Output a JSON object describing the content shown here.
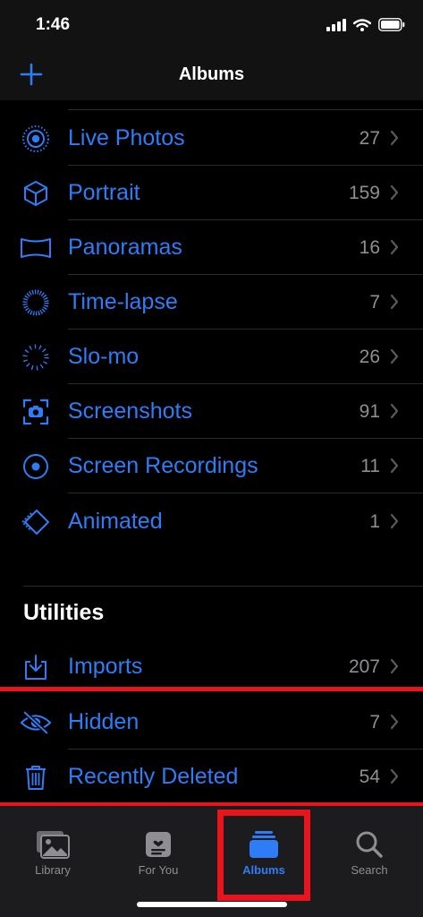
{
  "status_bar": {
    "time": "1:46"
  },
  "nav": {
    "title": "Albums",
    "add_icon": "plus-icon"
  },
  "media_types": [
    {
      "id": "live-photos",
      "label": "Live Photos",
      "count": "27",
      "icon": "live-photo-icon"
    },
    {
      "id": "portrait",
      "label": "Portrait",
      "count": "159",
      "icon": "cube-icon"
    },
    {
      "id": "panoramas",
      "label": "Panoramas",
      "count": "16",
      "icon": "panorama-icon"
    },
    {
      "id": "time-lapse",
      "label": "Time-lapse",
      "count": "7",
      "icon": "timelapse-icon"
    },
    {
      "id": "slo-mo",
      "label": "Slo-mo",
      "count": "26",
      "icon": "slomo-icon"
    },
    {
      "id": "screenshots",
      "label": "Screenshots",
      "count": "91",
      "icon": "screenshot-icon"
    },
    {
      "id": "screen-recordings",
      "label": "Screen Recordings",
      "count": "11",
      "icon": "record-icon"
    },
    {
      "id": "animated",
      "label": "Animated",
      "count": "1",
      "icon": "animated-icon"
    }
  ],
  "utilities": {
    "title": "Utilities",
    "items": [
      {
        "id": "imports",
        "label": "Imports",
        "count": "207",
        "icon": "import-icon"
      },
      {
        "id": "hidden",
        "label": "Hidden",
        "count": "7",
        "icon": "eye-slash-icon"
      },
      {
        "id": "recently-deleted",
        "label": "Recently Deleted",
        "count": "54",
        "icon": "trash-icon"
      }
    ]
  },
  "tabs": [
    {
      "id": "library",
      "label": "Library",
      "icon": "photos-icon",
      "active": false
    },
    {
      "id": "for-you",
      "label": "For You",
      "icon": "for-you-icon",
      "active": false
    },
    {
      "id": "albums",
      "label": "Albums",
      "icon": "albums-icon",
      "active": true
    },
    {
      "id": "search",
      "label": "Search",
      "icon": "search-icon",
      "active": false
    }
  ],
  "colors": {
    "accent": "#2f7df6",
    "highlight": "#e8141c",
    "secondary_text": "#8e8e93",
    "background": "#000000"
  }
}
